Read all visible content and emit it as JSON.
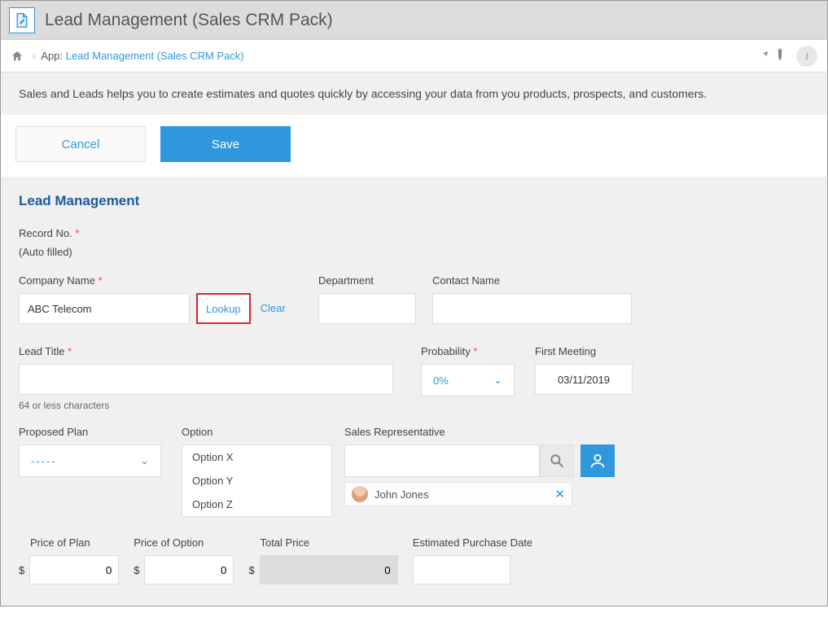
{
  "header": {
    "title": "Lead Management (Sales CRM Pack)"
  },
  "breadcrumb": {
    "prefix": "App:",
    "link": "Lead Management (Sales CRM Pack)"
  },
  "description": "Sales and Leads helps you to create estimates and quotes quickly by accessing your data from you products, prospects, and customers.",
  "actions": {
    "cancel": "Cancel",
    "save": "Save"
  },
  "form": {
    "section_title": "Lead Management",
    "record_no": {
      "label": "Record No.",
      "required": true,
      "note": "(Auto filled)"
    },
    "company_name": {
      "label": "Company Name",
      "required": true,
      "value": "ABC Telecom",
      "lookup": "Lookup",
      "clear": "Clear"
    },
    "department": {
      "label": "Department",
      "value": ""
    },
    "contact_name": {
      "label": "Contact Name",
      "value": ""
    },
    "lead_title": {
      "label": "Lead Title",
      "required": true,
      "value": "",
      "hint": "64 or less characters"
    },
    "probability": {
      "label": "Probability",
      "required": true,
      "value": "0%"
    },
    "first_meeting": {
      "label": "First Meeting",
      "value": "03/11/2019"
    },
    "proposed_plan": {
      "label": "Proposed Plan",
      "value": "-----"
    },
    "option": {
      "label": "Option",
      "items": [
        "Option X",
        "Option Y",
        "Option Z"
      ]
    },
    "sales_rep": {
      "label": "Sales Representative",
      "value": "",
      "selected_user": "John Jones"
    },
    "price_plan": {
      "label": "Price of Plan",
      "currency": "$",
      "value": "0"
    },
    "price_option": {
      "label": "Price of Option",
      "currency": "$",
      "value": "0"
    },
    "total_price": {
      "label": "Total Price",
      "currency": "$",
      "value": "0"
    },
    "est_purchase": {
      "label": "Estimated Purchase Date",
      "value": ""
    }
  }
}
